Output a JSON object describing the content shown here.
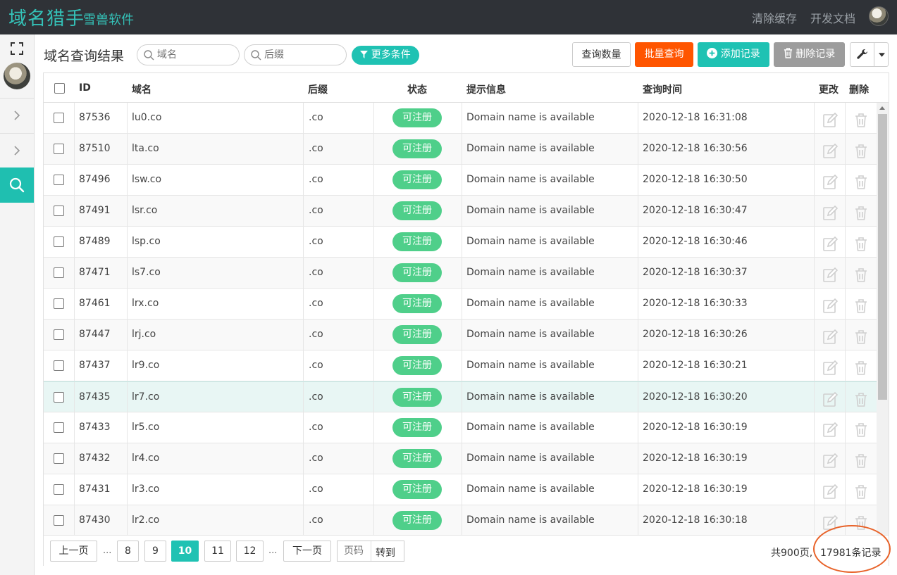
{
  "app": {
    "brand": "域名猎手",
    "brand_sub": "雪兽软件",
    "clear_cache": "清除缓存",
    "dev_docs": "开发文档"
  },
  "toolbar": {
    "title": "域名查询结果",
    "domain_placeholder": "域名",
    "suffix_placeholder": "后缀",
    "more_conditions": "更多条件",
    "query_count": "查询数量",
    "batch_query": "批量查询",
    "add_record": "添加记录",
    "delete_record": "删除记录"
  },
  "table": {
    "headers": {
      "id": "ID",
      "domain": "域名",
      "suffix": "后缀",
      "status": "状态",
      "info": "提示信息",
      "time": "查询时间",
      "edit": "更改",
      "delete": "删除"
    },
    "rows": [
      {
        "id": "87536",
        "domain": "lu0.co",
        "suffix": ".co",
        "status": "可注册",
        "info": "Domain name is available",
        "time": "2020-12-18 16:31:08"
      },
      {
        "id": "87510",
        "domain": "lta.co",
        "suffix": ".co",
        "status": "可注册",
        "info": "Domain name is available",
        "time": "2020-12-18 16:30:56"
      },
      {
        "id": "87496",
        "domain": "lsw.co",
        "suffix": ".co",
        "status": "可注册",
        "info": "Domain name is available",
        "time": "2020-12-18 16:30:50"
      },
      {
        "id": "87491",
        "domain": "lsr.co",
        "suffix": ".co",
        "status": "可注册",
        "info": "Domain name is available",
        "time": "2020-12-18 16:30:47"
      },
      {
        "id": "87489",
        "domain": "lsp.co",
        "suffix": ".co",
        "status": "可注册",
        "info": "Domain name is available",
        "time": "2020-12-18 16:30:46"
      },
      {
        "id": "87471",
        "domain": "ls7.co",
        "suffix": ".co",
        "status": "可注册",
        "info": "Domain name is available",
        "time": "2020-12-18 16:30:37"
      },
      {
        "id": "87461",
        "domain": "lrx.co",
        "suffix": ".co",
        "status": "可注册",
        "info": "Domain name is available",
        "time": "2020-12-18 16:30:33"
      },
      {
        "id": "87447",
        "domain": "lrj.co",
        "suffix": ".co",
        "status": "可注册",
        "info": "Domain name is available",
        "time": "2020-12-18 16:30:26"
      },
      {
        "id": "87437",
        "domain": "lr9.co",
        "suffix": ".co",
        "status": "可注册",
        "info": "Domain name is available",
        "time": "2020-12-18 16:30:21"
      },
      {
        "id": "87435",
        "domain": "lr7.co",
        "suffix": ".co",
        "status": "可注册",
        "info": "Domain name is available",
        "time": "2020-12-18 16:30:20"
      },
      {
        "id": "87433",
        "domain": "lr5.co",
        "suffix": ".co",
        "status": "可注册",
        "info": "Domain name is available",
        "time": "2020-12-18 16:30:19"
      },
      {
        "id": "87432",
        "domain": "lr4.co",
        "suffix": ".co",
        "status": "可注册",
        "info": "Domain name is available",
        "time": "2020-12-18 16:30:19"
      },
      {
        "id": "87431",
        "domain": "lr3.co",
        "suffix": ".co",
        "status": "可注册",
        "info": "Domain name is available",
        "time": "2020-12-18 16:30:19"
      },
      {
        "id": "87430",
        "domain": "lr2.co",
        "suffix": ".co",
        "status": "可注册",
        "info": "Domain name is available",
        "time": "2020-12-18 16:30:18"
      }
    ]
  },
  "pager": {
    "prev": "上一页",
    "next": "下一页",
    "dots": "...",
    "pages": [
      "8",
      "9",
      "10",
      "11",
      "12"
    ],
    "current": "10",
    "page_placeholder": "页码",
    "goto": "转到",
    "total_pages": "共900页,",
    "total_records": "17981条记录"
  },
  "colors": {
    "accent": "#1fc2b3",
    "topbar": "#2f3237",
    "batch": "#ff5500",
    "status_badge": "#4fcf8a",
    "annotation_circle": "#e8632a"
  },
  "icons": [
    "expand-icon",
    "chevron-right-icon",
    "search-icon",
    "filter-icon",
    "plus-circle-icon",
    "trash-icon",
    "wrench-icon",
    "caret-down-icon",
    "edit-icon"
  ]
}
